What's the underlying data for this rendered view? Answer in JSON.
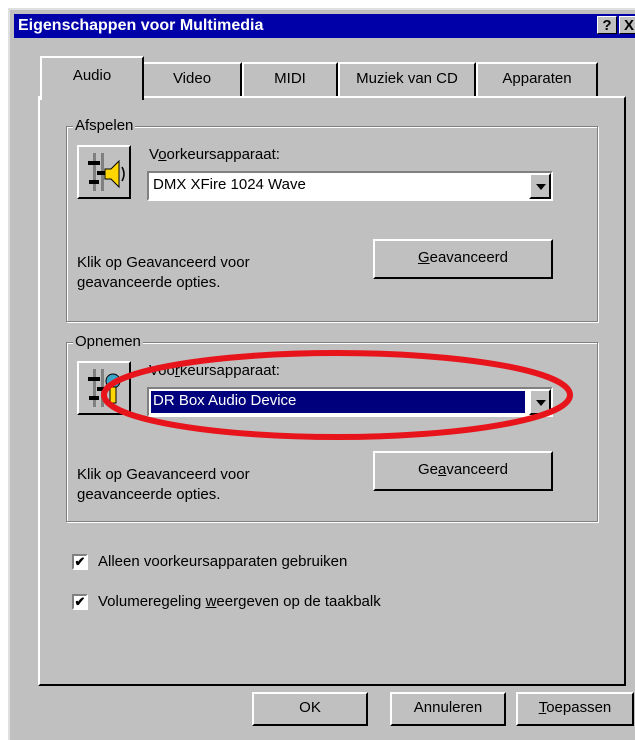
{
  "window": {
    "title": "Eigenschappen voor Multimedia",
    "help_label": "?",
    "close_label": "X"
  },
  "tabs": [
    {
      "label": "Audio",
      "active": true
    },
    {
      "label": "Video"
    },
    {
      "label": "MIDI"
    },
    {
      "label": "Muziek van CD"
    },
    {
      "label": "Apparaten"
    }
  ],
  "playback": {
    "group_label": "Afspelen",
    "preferred_label_pre": "V",
    "preferred_label_u": "o",
    "preferred_label_post": "orkeursapparaat:",
    "device_value": "DMX XFire 1024 Wave",
    "info_line1": "Klik op Geavanceerd voor",
    "info_line2": "geavanceerde opties.",
    "advanced_u": "G",
    "advanced_rest": "eavanceerd"
  },
  "recording": {
    "group_label": "Opnemen",
    "preferred_label_pre": "Voo",
    "preferred_label_u": "r",
    "preferred_label_post": "keursapparaat:",
    "device_value": "DR Box Audio Device",
    "info_line1": "Klik op Geavanceerd voor",
    "info_line2": "geavanceerde opties.",
    "advanced_pre": "Ge",
    "advanced_u": "a",
    "advanced_rest": "vanceerd"
  },
  "options": {
    "only_preferred_pre": "Alleen voorkeursapparaten ",
    "only_preferred_u": "g",
    "only_preferred_post": "ebruiken",
    "only_preferred_checked": true,
    "volume_pre": "Volumeregeling ",
    "volume_u": "w",
    "volume_post": "eergeven op de taakbalk",
    "volume_checked": true,
    "check_glyph": "✔"
  },
  "buttons": {
    "ok": "OK",
    "cancel": "Annuleren",
    "apply_u": "T",
    "apply_rest": "oepassen"
  },
  "highlight_color": "#e8141b"
}
